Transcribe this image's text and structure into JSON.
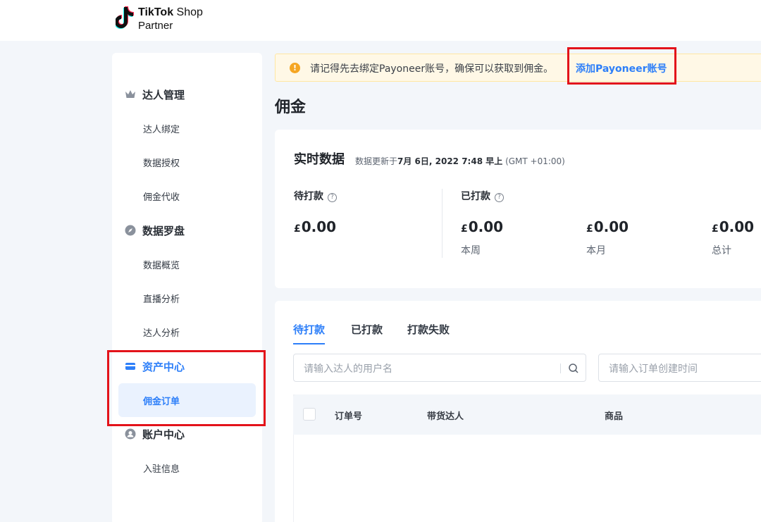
{
  "header": {
    "logo_line1_bold": "TikTok",
    "logo_line1_light": "Shop",
    "logo_line2": "Partner"
  },
  "sidebar": {
    "groups": [
      {
        "label": "达人管理",
        "icon": "crown-icon",
        "items": [
          "达人绑定",
          "数据授权",
          "佣金代收"
        ]
      },
      {
        "label": "数据罗盘",
        "icon": "compass-icon",
        "items": [
          "数据概览",
          "直播分析",
          "达人分析"
        ]
      },
      {
        "label": "资产中心",
        "icon": "card-icon",
        "items": [
          "佣金订单"
        ]
      },
      {
        "label": "账户中心",
        "icon": "user-icon",
        "items": [
          "入驻信息"
        ]
      }
    ]
  },
  "notice": {
    "text": "请记得先去绑定Payoneer账号，确保可以获取到佣金。",
    "link": "添加Payoneer账号"
  },
  "page": {
    "title": "佣金"
  },
  "realtime": {
    "title": "实时数据",
    "update_prefix": "数据更新于",
    "update_time": "7月 6日, 2022 7:48 早上",
    "update_tz": "(GMT +01:00)",
    "pending_label": "待打款",
    "paid_label": "已打款",
    "currency": "£",
    "pending_amount": "0.00",
    "paid": [
      {
        "amount": "0.00",
        "label": "本周"
      },
      {
        "amount": "0.00",
        "label": "本月"
      },
      {
        "amount": "0.00",
        "label": "总计"
      }
    ]
  },
  "orders": {
    "tabs": [
      "待打款",
      "已打款",
      "打款失败"
    ],
    "search_placeholder": "请输入达人的用户名",
    "date_placeholder": "请输入订单创建时间",
    "columns": [
      "订单号",
      "带货达人",
      "商品"
    ]
  },
  "colors": {
    "accent": "#2d7ff9",
    "highlight_box": "#e3131a",
    "notice_bg": "#fff8e6",
    "notice_icon": "#f5a623"
  }
}
